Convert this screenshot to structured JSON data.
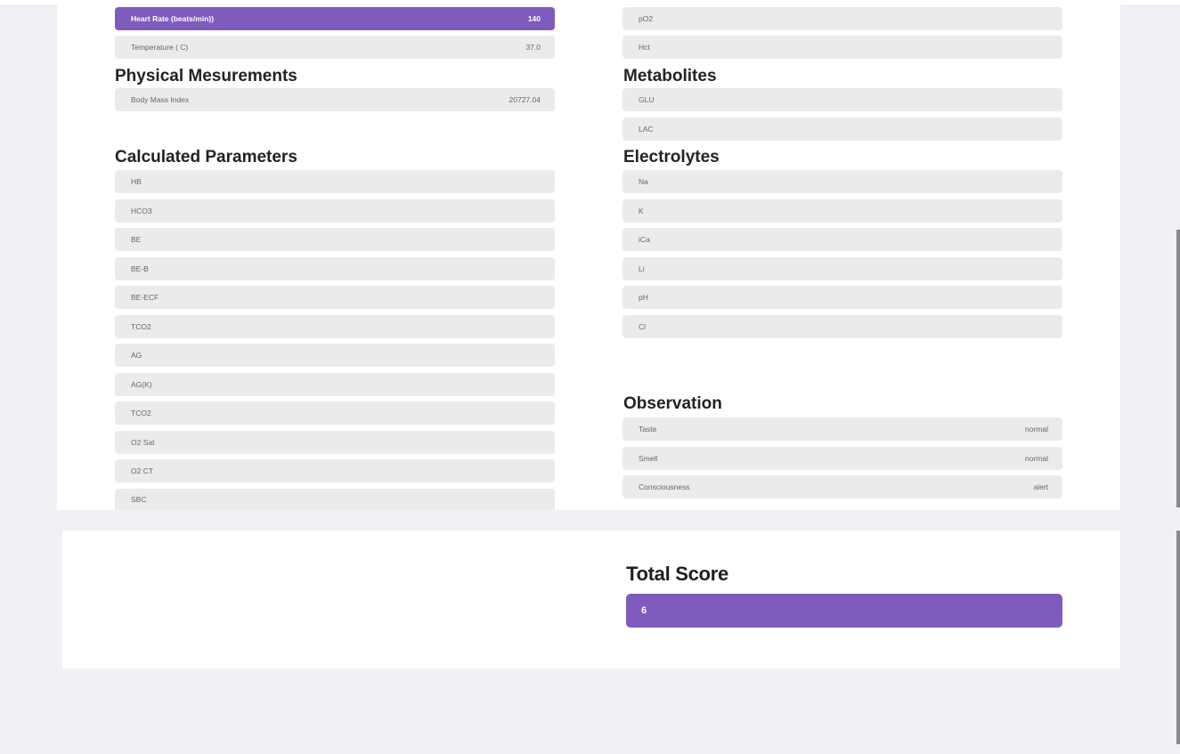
{
  "vitals": [
    {
      "label": "Heart Rate (beats/min))",
      "value": "140",
      "highlight": true
    },
    {
      "label": "Temperature ( C)",
      "value": "37.0",
      "highlight": false
    }
  ],
  "blood_gas_right": [
    {
      "label": "pO2",
      "value": ""
    },
    {
      "label": "Hct",
      "value": ""
    }
  ],
  "physical": {
    "title": "Physical Mesurements",
    "items": [
      {
        "label": "Body Mass Index",
        "value": "20727.04"
      }
    ]
  },
  "metabolites": {
    "title": "Metabolites",
    "items": [
      {
        "label": "GLU",
        "value": ""
      },
      {
        "label": "LAC",
        "value": ""
      }
    ]
  },
  "calculated": {
    "title": "Calculated Parameters",
    "items": [
      {
        "label": "HB",
        "value": ""
      },
      {
        "label": "HCO3",
        "value": ""
      },
      {
        "label": "BE",
        "value": ""
      },
      {
        "label": "BE-B",
        "value": ""
      },
      {
        "label": "BE-ECF",
        "value": ""
      },
      {
        "label": "TCO2",
        "value": ""
      },
      {
        "label": "AG",
        "value": ""
      },
      {
        "label": "AG(K)",
        "value": ""
      },
      {
        "label": "TCO2",
        "value": ""
      },
      {
        "label": "O2 Sat",
        "value": ""
      },
      {
        "label": "O2 CT",
        "value": ""
      },
      {
        "label": "SBC",
        "value": ""
      }
    ]
  },
  "electrolytes": {
    "title": "Electrolytes",
    "items": [
      {
        "label": "Na",
        "value": ""
      },
      {
        "label": "K",
        "value": ""
      },
      {
        "label": "iCa",
        "value": ""
      },
      {
        "label": "Li",
        "value": ""
      },
      {
        "label": "pH",
        "value": ""
      },
      {
        "label": "Cl",
        "value": ""
      }
    ]
  },
  "observation": {
    "title": "Observation",
    "items": [
      {
        "label": "Taste",
        "value": "normal"
      },
      {
        "label": "Smell",
        "value": "normal"
      },
      {
        "label": "Consciousness",
        "value": "alert"
      }
    ]
  },
  "total": {
    "title": "Total Score",
    "value": "6"
  },
  "colors": {
    "accent": "#7f5bbd",
    "row_bg": "#ebebeb",
    "page_bg": "#f0f1f5"
  }
}
